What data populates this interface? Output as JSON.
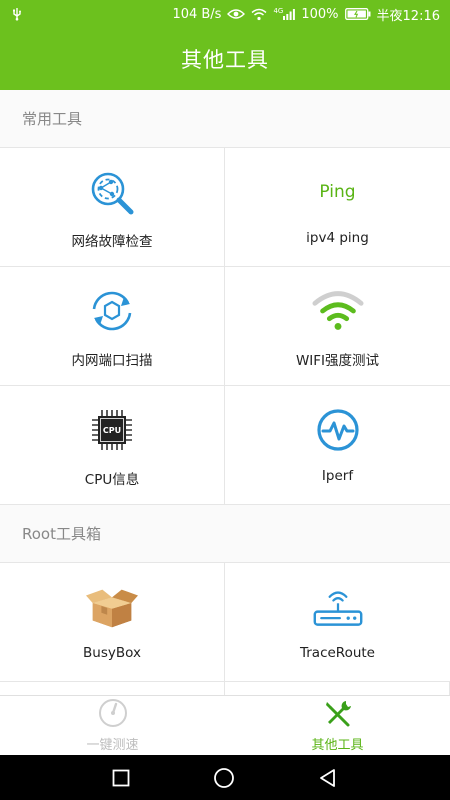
{
  "status": {
    "speed": "104 B/s",
    "signal_tag": "4G",
    "battery": "100%",
    "time": "半夜12:16"
  },
  "appbar": {
    "title": "其他工具"
  },
  "sections": [
    {
      "title": "常用工具",
      "items": [
        {
          "label": "网络故障检查",
          "icon": "network-diagnose-icon"
        },
        {
          "label": "ipv4 ping",
          "icon": "ping-icon",
          "icon_text": "Ping"
        },
        {
          "label": "内网端口扫描",
          "icon": "port-scan-icon"
        },
        {
          "label": "WIFI强度测试",
          "icon": "wifi-strength-icon"
        },
        {
          "label": "CPU信息",
          "icon": "cpu-icon",
          "icon_text": "CPU"
        },
        {
          "label": "Iperf",
          "icon": "iperf-icon"
        }
      ]
    },
    {
      "title": "Root工具箱",
      "items": [
        {
          "label": "BusyBox",
          "icon": "box-icon"
        },
        {
          "label": "TraceRoute",
          "icon": "router-icon"
        }
      ]
    }
  ],
  "bottom_nav": [
    {
      "label": "一键测速",
      "icon": "speedometer-icon",
      "active": false
    },
    {
      "label": "其他工具",
      "icon": "tools-icon",
      "active": true
    }
  ],
  "colors": {
    "brand": "#6cc11e",
    "accent_blue": "#2b93d6",
    "active_nav": "#59b414"
  }
}
